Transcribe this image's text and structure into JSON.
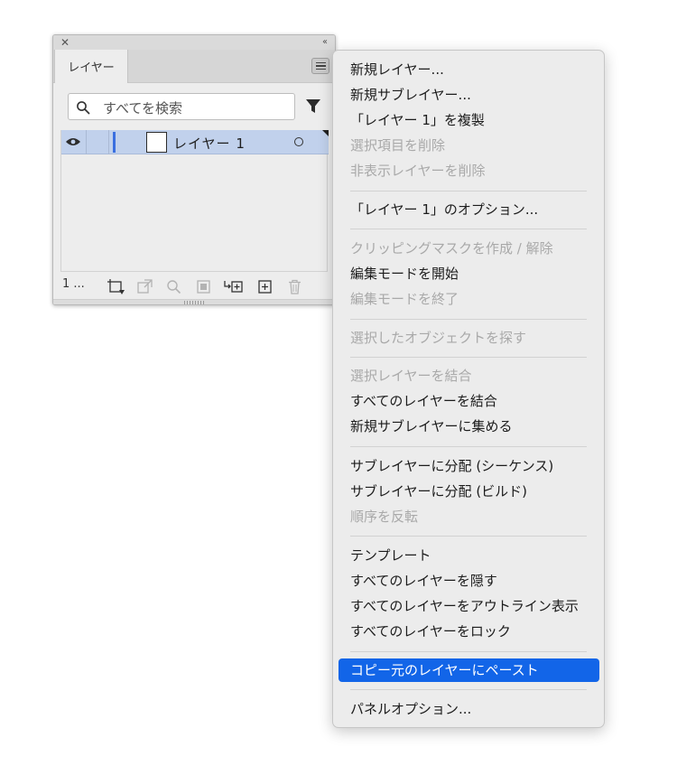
{
  "panel": {
    "close_glyph": "✕",
    "collapse_glyph": "‹‹",
    "tab_label": "レイヤー",
    "menu_icon": "hamburger-icon",
    "search": {
      "placeholder": "すべてを検索",
      "icon": "search-icon"
    },
    "filter_icon": "filter-icon",
    "layers": [
      {
        "name": "レイヤー 1",
        "visible": true,
        "selected": true,
        "color": "#3a6fe0"
      }
    ],
    "layer_count": "1 ...",
    "accent_selection": "#c1d1ec"
  },
  "menu": {
    "highlight_color": "#1265e8",
    "items": [
      {
        "label": "新規レイヤー...",
        "enabled": true
      },
      {
        "label": "新規サブレイヤー...",
        "enabled": true
      },
      {
        "label": "「レイヤー 1」を複製",
        "enabled": true
      },
      {
        "label": "選択項目を削除",
        "enabled": false
      },
      {
        "label": "非表示レイヤーを削除",
        "enabled": false
      },
      {
        "label": "「レイヤー 1」のオプション...",
        "enabled": true
      },
      {
        "label": "クリッピングマスクを作成 / 解除",
        "enabled": false
      },
      {
        "label": "編集モードを開始",
        "enabled": true
      },
      {
        "label": "編集モードを終了",
        "enabled": false
      },
      {
        "label": "選択したオブジェクトを探す",
        "enabled": false
      },
      {
        "label": "選択レイヤーを結合",
        "enabled": false
      },
      {
        "label": "すべてのレイヤーを結合",
        "enabled": true
      },
      {
        "label": "新規サブレイヤーに集める",
        "enabled": true
      },
      {
        "label": "サブレイヤーに分配 (シーケンス)",
        "enabled": true
      },
      {
        "label": "サブレイヤーに分配 (ビルド)",
        "enabled": true
      },
      {
        "label": "順序を反転",
        "enabled": false
      },
      {
        "label": "テンプレート",
        "enabled": true
      },
      {
        "label": "すべてのレイヤーを隠す",
        "enabled": true
      },
      {
        "label": "すべてのレイヤーをアウトライン表示",
        "enabled": true
      },
      {
        "label": "すべてのレイヤーをロック",
        "enabled": true
      },
      {
        "label": "コピー元のレイヤーにペースト",
        "enabled": true,
        "highlighted": true
      },
      {
        "label": "パネルオプション...",
        "enabled": true
      }
    ]
  }
}
